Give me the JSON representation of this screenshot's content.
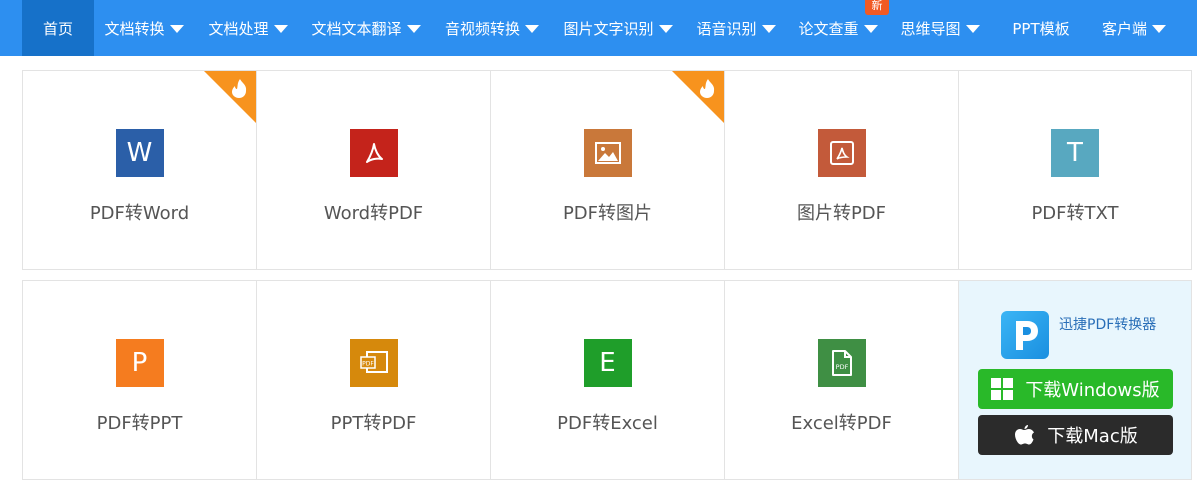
{
  "nav": {
    "items": [
      {
        "label": "首页",
        "dropdown": false,
        "active": true
      },
      {
        "label": "文档转换",
        "dropdown": true
      },
      {
        "label": "文档处理",
        "dropdown": true
      },
      {
        "label": "文档文本翻译",
        "dropdown": true
      },
      {
        "label": "音视频转换",
        "dropdown": true
      },
      {
        "label": "图片文字识别",
        "dropdown": true
      },
      {
        "label": "语音识别",
        "dropdown": true
      },
      {
        "label": "论文查重",
        "dropdown": true
      },
      {
        "label": "思维导图",
        "dropdown": true
      },
      {
        "label": "PPT模板",
        "dropdown": false
      },
      {
        "label": "客户端",
        "dropdown": true
      }
    ],
    "new_badge": "新"
  },
  "tools_row1": [
    {
      "label": "PDF转Word",
      "glyph": "W",
      "color": "#2b5fa8",
      "hot": true,
      "icon": "word-icon"
    },
    {
      "label": "Word转PDF",
      "glyph": "",
      "color": "#c4231b",
      "hot": false,
      "icon": "pdf-icon"
    },
    {
      "label": "PDF转图片",
      "glyph": "",
      "color": "#c9783a",
      "hot": true,
      "icon": "image-icon"
    },
    {
      "label": "图片转PDF",
      "glyph": "",
      "color": "#c35a3a",
      "hot": false,
      "icon": "image-pdf-icon"
    },
    {
      "label": "PDF转TXT",
      "glyph": "T",
      "color": "#58a8c0",
      "hot": false,
      "icon": "txt-icon"
    }
  ],
  "tools_row2": [
    {
      "label": "PDF转PPT",
      "glyph": "P",
      "color": "#f57c1f",
      "icon": "ppt-icon"
    },
    {
      "label": "PPT转PDF",
      "glyph": "",
      "color": "#d6890c",
      "icon": "ppt-pdf-icon"
    },
    {
      "label": "PDF转Excel",
      "glyph": "E",
      "color": "#1f9e2a",
      "icon": "excel-icon"
    },
    {
      "label": "Excel转PDF",
      "glyph": "",
      "color": "#3f8f44",
      "icon": "excel-pdf-icon"
    }
  ],
  "promo": {
    "title": "迅捷PDF转换器",
    "win_label": "下载Windows版",
    "mac_label": "下载Mac版",
    "win_color": "#29b929",
    "mac_color": "#2b2b2b"
  },
  "colors": {
    "nav_bg": "#2d8ff0",
    "nav_active": "#1671c9",
    "badge": "#f15a24",
    "hot_ribbon": "#f7931e"
  }
}
